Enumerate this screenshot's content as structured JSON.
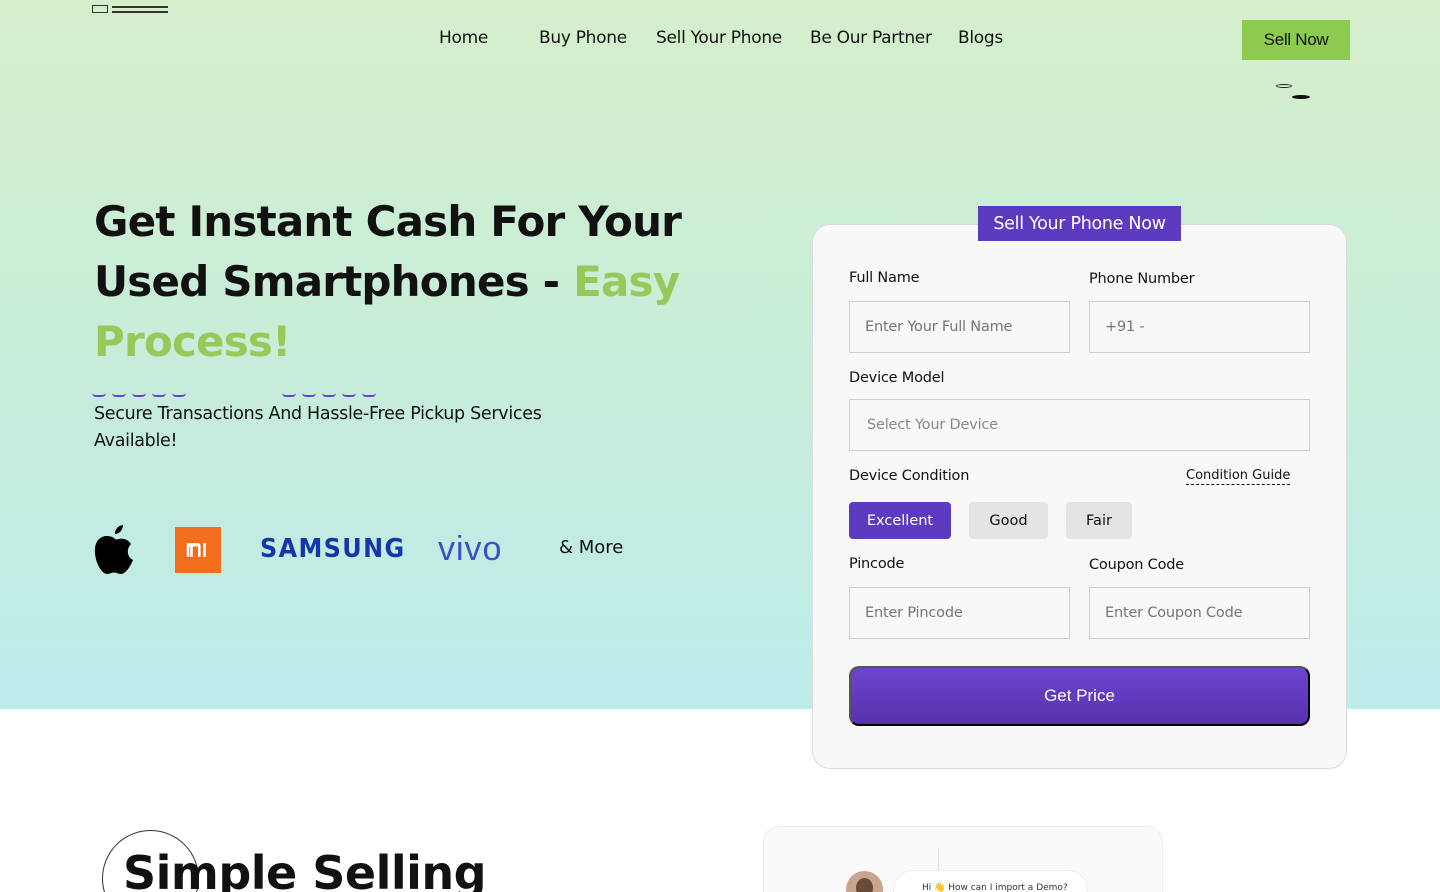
{
  "nav": {
    "items": [
      "Home",
      "Buy Phone",
      "Sell Your Phone",
      "Be Our Partner",
      "Blogs"
    ],
    "cta": "Sell Now"
  },
  "hero": {
    "headline_part1": "Get Instant Cash For Your Used Smartphones - ",
    "headline_accent": "Easy Process!",
    "subtext": "Secure Transactions And Hassle-Free Pickup Services Available!",
    "brands": [
      "apple-logo",
      "mi-logo",
      "SAMSUNG",
      "vivo"
    ],
    "more": "& More"
  },
  "form": {
    "tag": "Sell Your Phone Now",
    "full_name_label": "Full Name",
    "full_name_placeholder": "Enter Your Full Name",
    "phone_label": "Phone Number",
    "phone_placeholder": "+91 -",
    "device_label": "Device Model",
    "device_placeholder": "Select Your Device",
    "condition_label": "Device Condition",
    "condition_guide": "Condition Guide",
    "conditions": [
      "Excellent",
      "Good",
      "Fair"
    ],
    "selected_condition": "Excellent",
    "pincode_label": "Pincode",
    "pincode_placeholder": "Enter Pincode",
    "coupon_label": "Coupon Code",
    "coupon_placeholder": "Enter Coupon Code",
    "submit": "Get Price"
  },
  "section2": {
    "title": "Simple Selling",
    "chat_message": "Hi 👋 How can I import a Demo?"
  },
  "colors": {
    "brand_purple": "#5c3bc0",
    "brand_green": "#8ccb4f",
    "accent_text_green": "#97c95a"
  }
}
